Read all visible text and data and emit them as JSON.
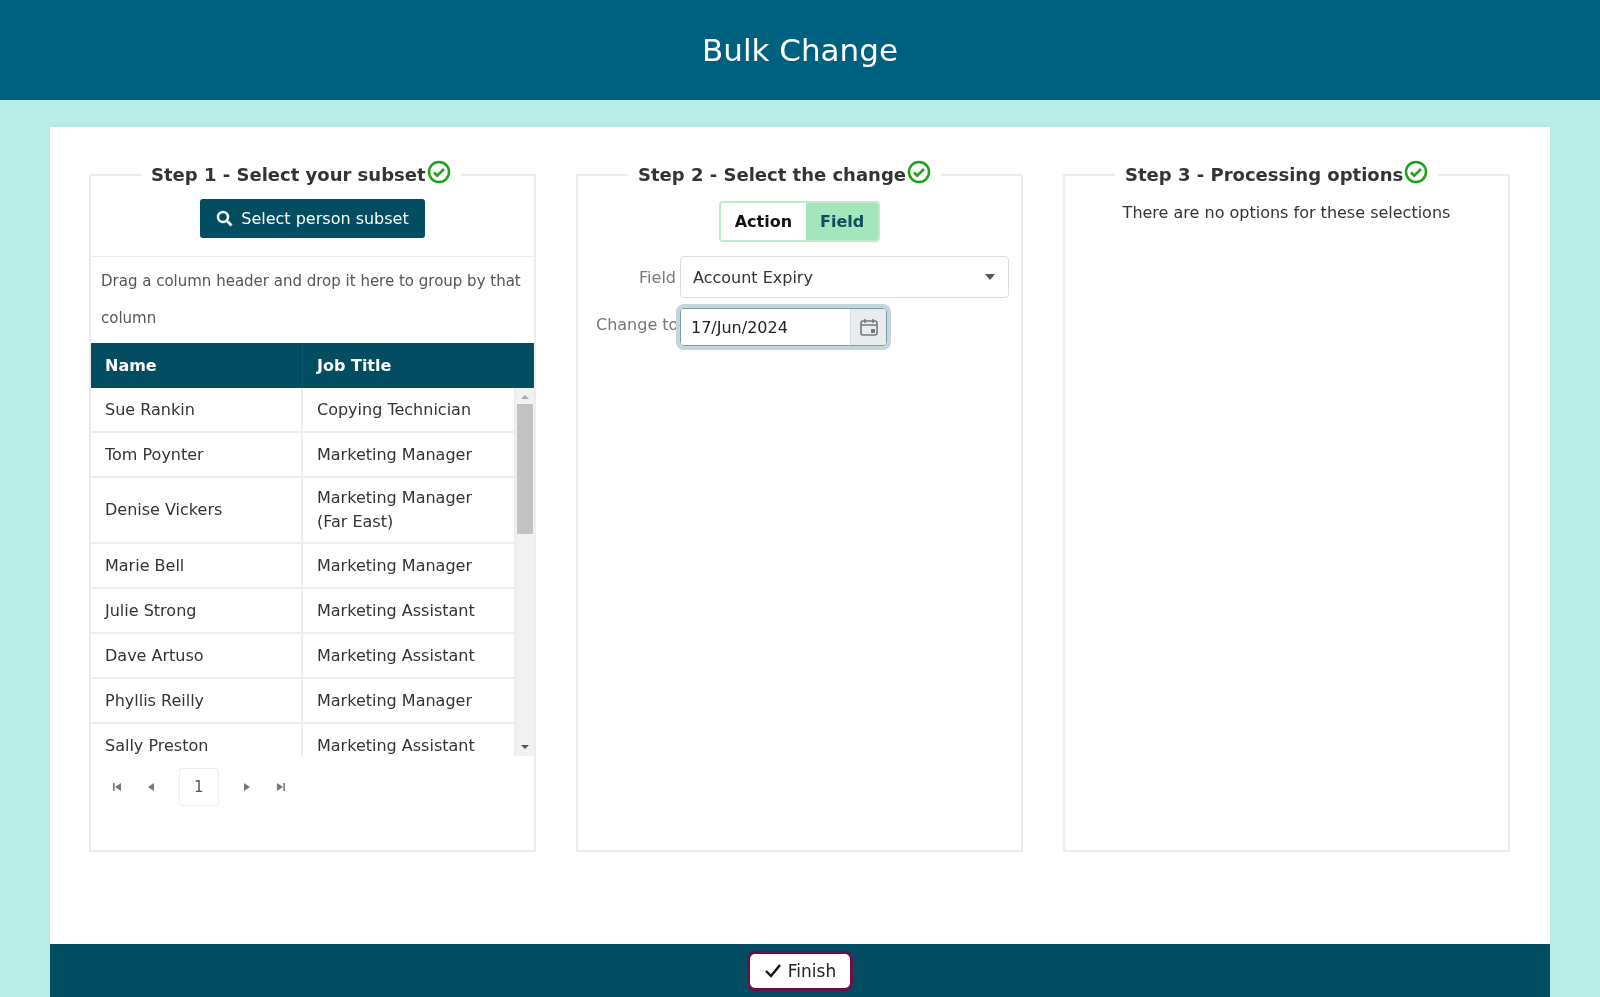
{
  "header": {
    "title": "Bulk Change"
  },
  "step1": {
    "title": "Step 1 - Select your subset",
    "complete": true,
    "button": "Select person subset",
    "group_hint": "Drag a column header and drop it here to group by that column",
    "table": {
      "columns": [
        "Name",
        "Job Title"
      ],
      "rows": [
        [
          "Sue Rankin",
          "Copying Technician"
        ],
        [
          "Tom Poynter",
          "Marketing Manager"
        ],
        [
          "Denise Vickers",
          "Marketing Manager (Far East)"
        ],
        [
          "Marie Bell",
          "Marketing Manager"
        ],
        [
          "Julie Strong",
          "Marketing Assistant"
        ],
        [
          "Dave Artuso",
          "Marketing Assistant"
        ],
        [
          "Phyllis Reilly",
          "Marketing Manager"
        ],
        [
          "Sally Preston",
          "Marketing Assistant"
        ]
      ]
    },
    "pager": {
      "page": "1"
    }
  },
  "step2": {
    "title": "Step 2 - Select the change",
    "complete": true,
    "tabs": [
      {
        "label": "Action",
        "selected": false
      },
      {
        "label": "Field",
        "selected": true
      }
    ],
    "field_label": "Field",
    "field_value": "Account Expiry",
    "change_label": "Change to",
    "change_value": "17/Jun/2024"
  },
  "step3": {
    "title": "Step 3 - Processing options",
    "complete": true,
    "message": "There are no options for these selections"
  },
  "footer": {
    "button": "Finish"
  }
}
